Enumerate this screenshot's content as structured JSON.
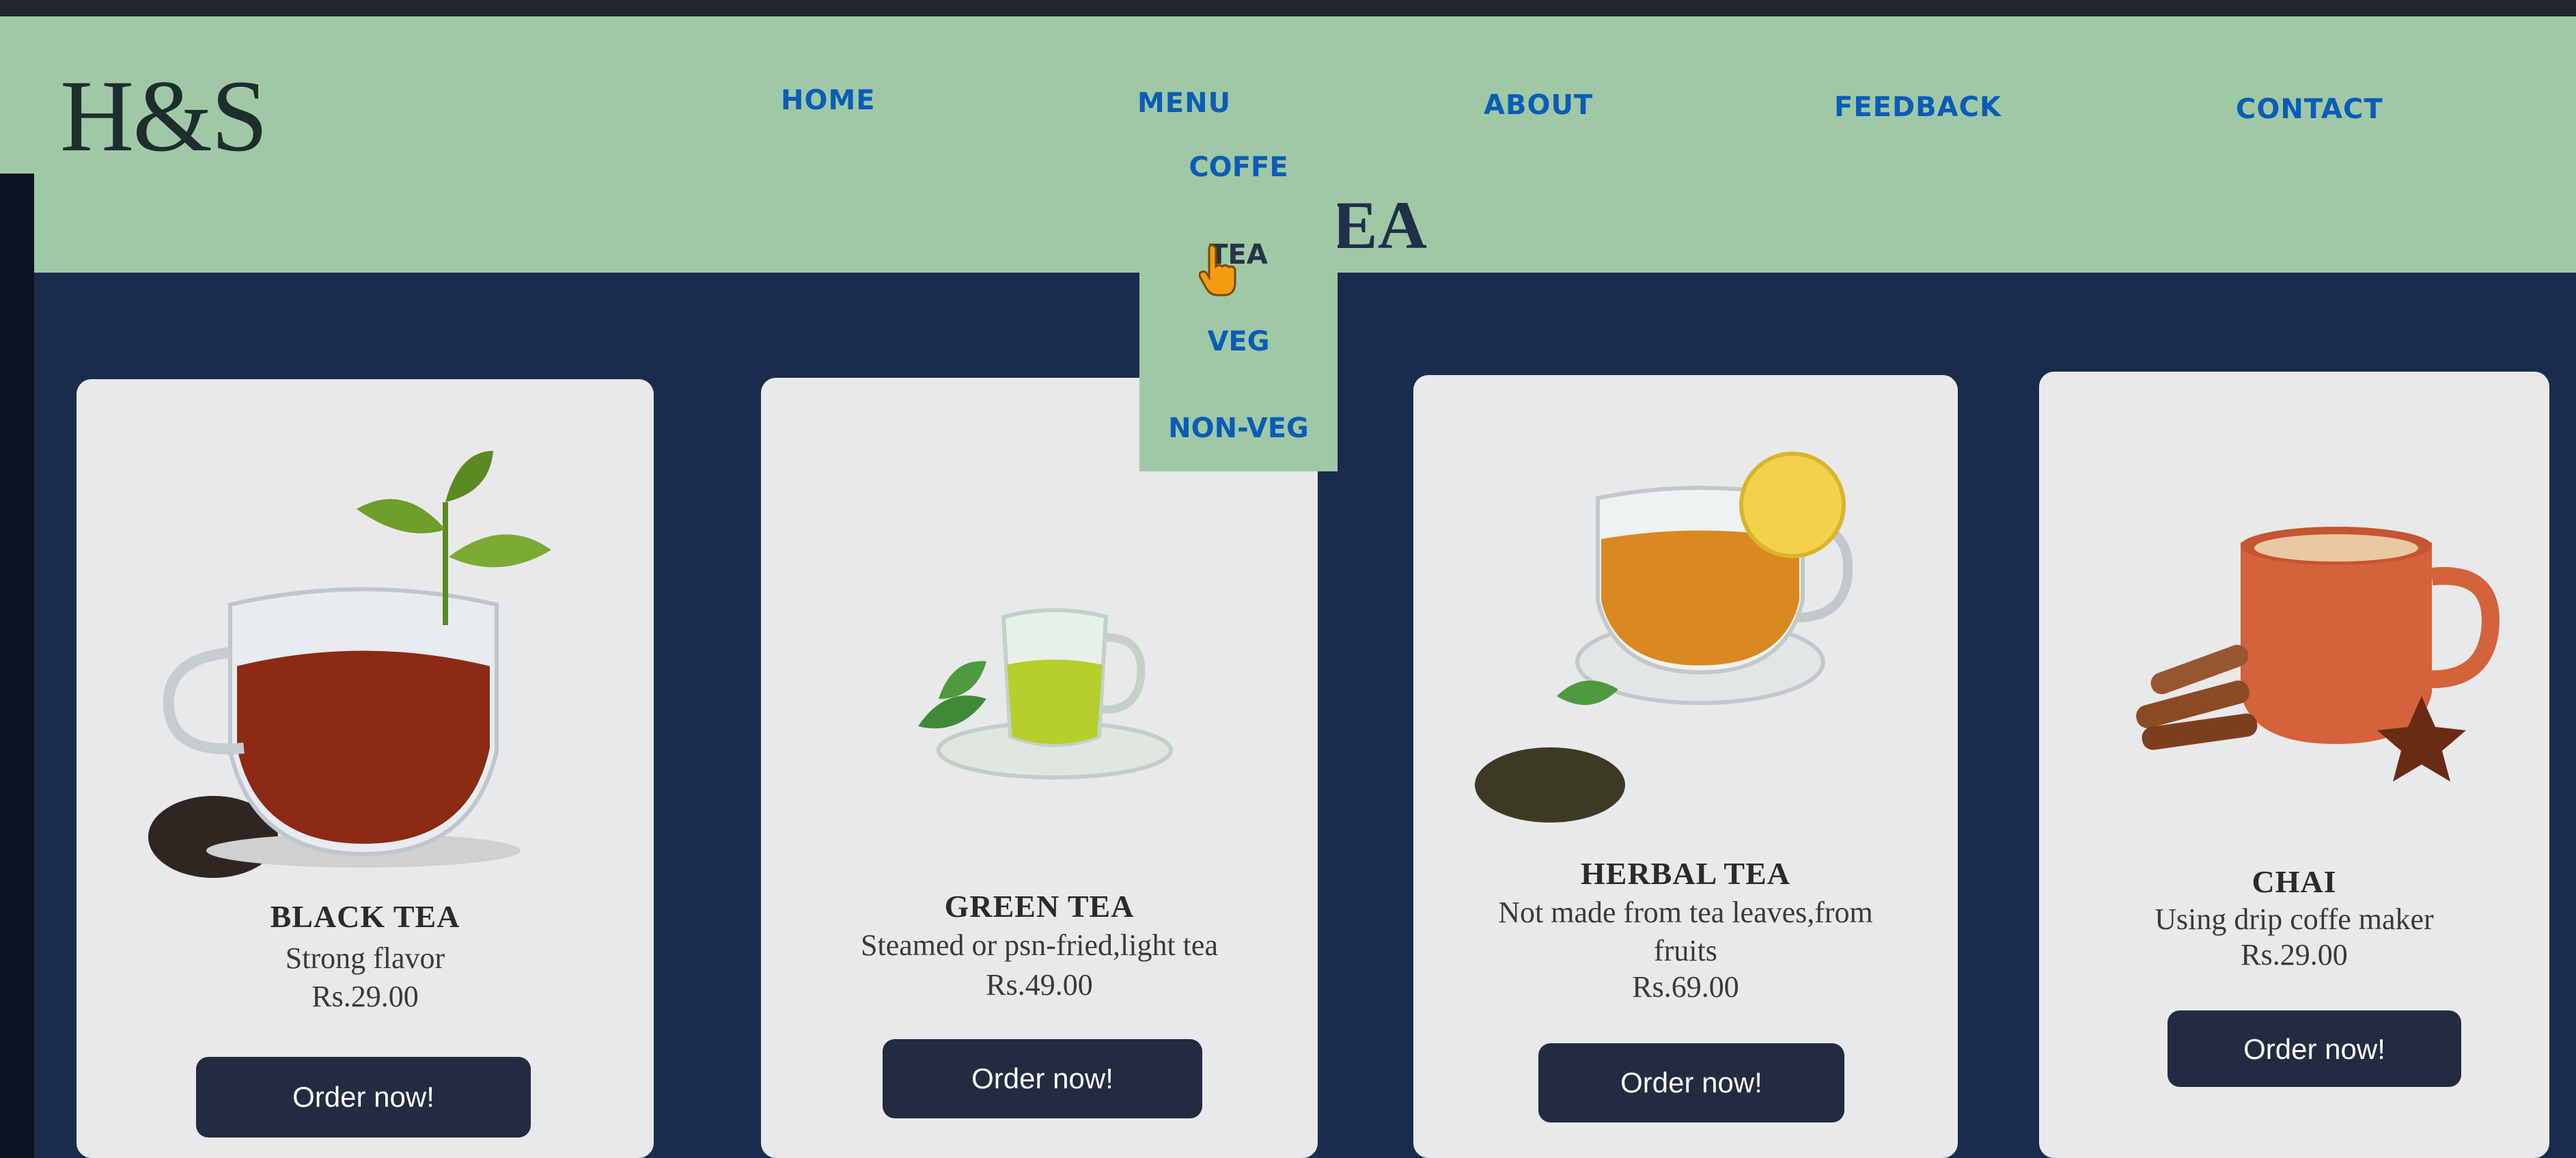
{
  "brand": {
    "logo": "H&S"
  },
  "nav": {
    "items": [
      {
        "label": "HOME"
      },
      {
        "label": "MENU"
      },
      {
        "label": "ABOUT"
      },
      {
        "label": "FEEDBACK"
      },
      {
        "label": "CONTACT"
      }
    ]
  },
  "menu_dropdown": {
    "items": [
      {
        "label": "COFFE"
      },
      {
        "label": "TEA"
      },
      {
        "label": "VEG"
      },
      {
        "label": "NON-VEG"
      }
    ],
    "hovered": "TEA"
  },
  "page": {
    "heading_visible": "EA"
  },
  "products": [
    {
      "name": "BLACK TEA",
      "description": "Strong flavor",
      "price": "Rs.29.00",
      "button": "Order now!",
      "image_icon": "black-tea-cup-icon"
    },
    {
      "name": "GREEN TEA",
      "description": "Steamed or psn-fried,light tea",
      "price": "Rs.49.00",
      "button": "Order now!",
      "image_icon": "green-tea-cup-icon"
    },
    {
      "name": "HERBAL TEA",
      "description_lines": [
        "Not made from tea leaves,from",
        "fruits"
      ],
      "price": "Rs.69.00",
      "button": "Order now!",
      "image_icon": "herbal-tea-cup-icon"
    },
    {
      "name": "CHAI",
      "description": "Using drip coffe maker",
      "price": "Rs.29.00",
      "button": "Order now!",
      "image_icon": "chai-mug-icon"
    }
  ],
  "colors": {
    "header_bg": "#9fc9a4",
    "link": "#0b5cb8",
    "main_bg": "#192c4e",
    "card_bg": "#e8e9ea",
    "button_bg": "#222b40"
  }
}
